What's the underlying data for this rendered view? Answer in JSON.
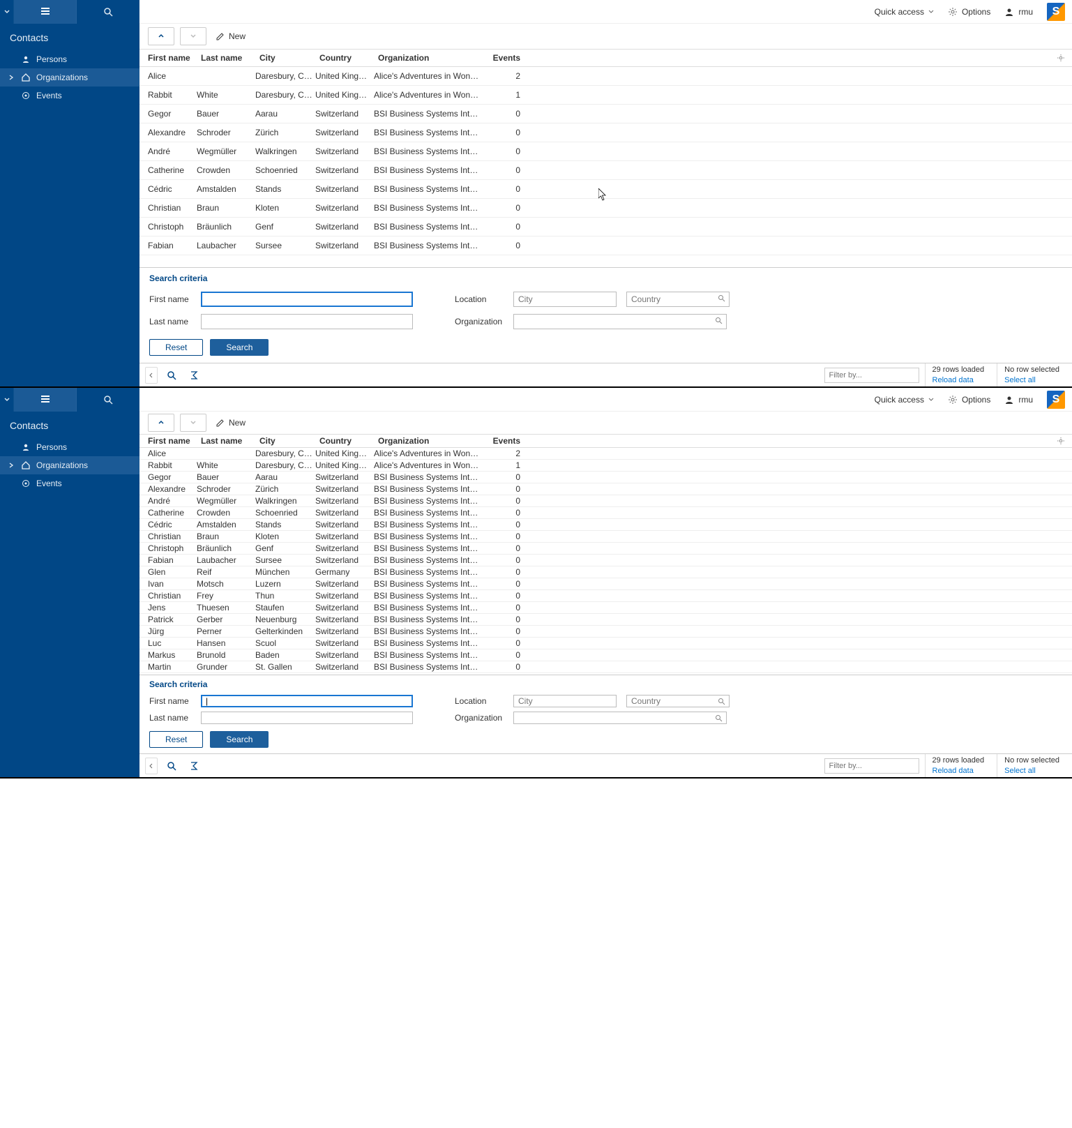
{
  "sidebar": {
    "title": "Contacts",
    "items": [
      {
        "label": "Persons",
        "icon": "person",
        "expandable": false
      },
      {
        "label": "Organizations",
        "icon": "home",
        "expandable": true
      },
      {
        "label": "Events",
        "icon": "target",
        "expandable": false
      }
    ]
  },
  "header": {
    "quick_access": "Quick access",
    "options": "Options",
    "user": "rmu",
    "logo_text": "S"
  },
  "toolbar": {
    "new_label": "New"
  },
  "table": {
    "columns": {
      "first_name": "First name",
      "last_name": "Last name",
      "city": "City",
      "country": "Country",
      "organization": "Organization",
      "events": "Events"
    },
    "rows_a": [
      {
        "fn": "Alice",
        "ln": "",
        "city": "Daresbury, Cheshire",
        "country": "United Kingdom",
        "org": "Alice's Adventures in Wonderland",
        "ev": "2"
      },
      {
        "fn": "Rabbit",
        "ln": "White",
        "city": "Daresbury, Cheshire",
        "country": "United Kingdom",
        "org": "Alice's Adventures in Wonderland",
        "ev": "1"
      },
      {
        "fn": "Gegor",
        "ln": "Bauer",
        "city": "Aarau",
        "country": "Switzerland",
        "org": "BSI Business Systems Integration AG",
        "ev": "0"
      },
      {
        "fn": "Alexandre",
        "ln": "Schroder",
        "city": "Zürich",
        "country": "Switzerland",
        "org": "BSI Business Systems Integration AG",
        "ev": "0"
      },
      {
        "fn": "André",
        "ln": "Wegmüller",
        "city": "Walkringen",
        "country": "Switzerland",
        "org": "BSI Business Systems Integration AG",
        "ev": "0"
      },
      {
        "fn": "Catherine",
        "ln": "Crowden",
        "city": "Schoenried",
        "country": "Switzerland",
        "org": "BSI Business Systems Integration AG",
        "ev": "0"
      },
      {
        "fn": "Cédric",
        "ln": "Amstalden",
        "city": "Stands",
        "country": "Switzerland",
        "org": "BSI Business Systems Integration AG",
        "ev": "0"
      },
      {
        "fn": "Christian",
        "ln": "Braun",
        "city": "Kloten",
        "country": "Switzerland",
        "org": "BSI Business Systems Integration AG",
        "ev": "0"
      },
      {
        "fn": "Christoph",
        "ln": "Bräunlich",
        "city": "Genf",
        "country": "Switzerland",
        "org": "BSI Business Systems Integration AG",
        "ev": "0"
      },
      {
        "fn": "Fabian",
        "ln": "Laubacher",
        "city": "Sursee",
        "country": "Switzerland",
        "org": "BSI Business Systems Integration AG",
        "ev": "0"
      }
    ],
    "rows_b": [
      {
        "fn": "Alice",
        "ln": "",
        "city": "Daresbury, Cheshire",
        "country": "United Kingdom",
        "org": "Alice's Adventures in Wonderland",
        "ev": "2"
      },
      {
        "fn": "Rabbit",
        "ln": "White",
        "city": "Daresbury, Cheshire",
        "country": "United Kingdom",
        "org": "Alice's Adventures in Wonderland",
        "ev": "1"
      },
      {
        "fn": "Gegor",
        "ln": "Bauer",
        "city": "Aarau",
        "country": "Switzerland",
        "org": "BSI Business Systems Integration AG",
        "ev": "0"
      },
      {
        "fn": "Alexandre",
        "ln": "Schroder",
        "city": "Zürich",
        "country": "Switzerland",
        "org": "BSI Business Systems Integration AG",
        "ev": "0"
      },
      {
        "fn": "André",
        "ln": "Wegmüller",
        "city": "Walkringen",
        "country": "Switzerland",
        "org": "BSI Business Systems Integration AG",
        "ev": "0"
      },
      {
        "fn": "Catherine",
        "ln": "Crowden",
        "city": "Schoenried",
        "country": "Switzerland",
        "org": "BSI Business Systems Integration AG",
        "ev": "0"
      },
      {
        "fn": "Cédric",
        "ln": "Amstalden",
        "city": "Stands",
        "country": "Switzerland",
        "org": "BSI Business Systems Integration AG",
        "ev": "0"
      },
      {
        "fn": "Christian",
        "ln": "Braun",
        "city": "Kloten",
        "country": "Switzerland",
        "org": "BSI Business Systems Integration AG",
        "ev": "0"
      },
      {
        "fn": "Christoph",
        "ln": "Bräunlich",
        "city": "Genf",
        "country": "Switzerland",
        "org": "BSI Business Systems Integration AG",
        "ev": "0"
      },
      {
        "fn": "Fabian",
        "ln": "Laubacher",
        "city": "Sursee",
        "country": "Switzerland",
        "org": "BSI Business Systems Integration AG",
        "ev": "0"
      },
      {
        "fn": "Glen",
        "ln": "Reif",
        "city": "München",
        "country": "Germany",
        "org": "BSI Business Systems Integration AG",
        "ev": "0"
      },
      {
        "fn": "Ivan",
        "ln": "Motsch",
        "city": "Luzern",
        "country": "Switzerland",
        "org": "BSI Business Systems Integration AG",
        "ev": "0"
      },
      {
        "fn": "Christian",
        "ln": "Frey",
        "city": "Thun",
        "country": "Switzerland",
        "org": "BSI Business Systems Integration AG",
        "ev": "0"
      },
      {
        "fn": "Jens",
        "ln": "Thuesen",
        "city": "Staufen",
        "country": "Switzerland",
        "org": "BSI Business Systems Integration AG",
        "ev": "0"
      },
      {
        "fn": "Patrick",
        "ln": "Gerber",
        "city": "Neuenburg",
        "country": "Switzerland",
        "org": "BSI Business Systems Integration AG",
        "ev": "0"
      },
      {
        "fn": "Jürg",
        "ln": "Perner",
        "city": "Gelterkinden",
        "country": "Switzerland",
        "org": "BSI Business Systems Integration AG",
        "ev": "0"
      },
      {
        "fn": "Luc",
        "ln": "Hansen",
        "city": "Scuol",
        "country": "Switzerland",
        "org": "BSI Business Systems Integration AG",
        "ev": "0"
      },
      {
        "fn": "Markus",
        "ln": "Brunold",
        "city": "Baden",
        "country": "Switzerland",
        "org": "BSI Business Systems Integration AG",
        "ev": "0"
      },
      {
        "fn": "Martin",
        "ln": "Grunder",
        "city": "St. Gallen",
        "country": "Switzerland",
        "org": "BSI Business Systems Integration AG",
        "ev": "0"
      }
    ]
  },
  "search": {
    "title": "Search criteria",
    "first_name_label": "First name",
    "last_name_label": "Last name",
    "location_label": "Location",
    "organization_label": "Organization",
    "city_placeholder": "City",
    "country_placeholder": "Country",
    "reset_label": "Reset",
    "search_label": "Search"
  },
  "footer": {
    "filter_placeholder": "Filter by...",
    "rows_loaded": "29 rows loaded",
    "reload_data": "Reload data",
    "no_row_selected": "No row selected",
    "select_all": "Select all"
  }
}
